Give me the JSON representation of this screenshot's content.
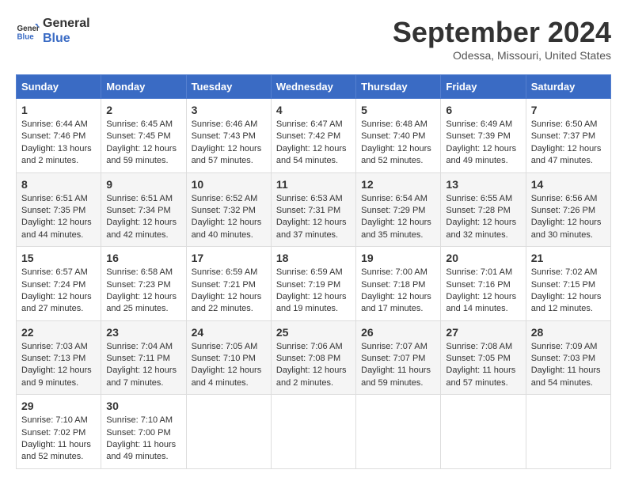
{
  "logo": {
    "line1": "General",
    "line2": "Blue"
  },
  "title": "September 2024",
  "location": "Odessa, Missouri, United States",
  "days_of_week": [
    "Sunday",
    "Monday",
    "Tuesday",
    "Wednesday",
    "Thursday",
    "Friday",
    "Saturday"
  ],
  "weeks": [
    [
      {
        "day": "1",
        "info": "Sunrise: 6:44 AM\nSunset: 7:46 PM\nDaylight: 13 hours\nand 2 minutes."
      },
      {
        "day": "2",
        "info": "Sunrise: 6:45 AM\nSunset: 7:45 PM\nDaylight: 12 hours\nand 59 minutes."
      },
      {
        "day": "3",
        "info": "Sunrise: 6:46 AM\nSunset: 7:43 PM\nDaylight: 12 hours\nand 57 minutes."
      },
      {
        "day": "4",
        "info": "Sunrise: 6:47 AM\nSunset: 7:42 PM\nDaylight: 12 hours\nand 54 minutes."
      },
      {
        "day": "5",
        "info": "Sunrise: 6:48 AM\nSunset: 7:40 PM\nDaylight: 12 hours\nand 52 minutes."
      },
      {
        "day": "6",
        "info": "Sunrise: 6:49 AM\nSunset: 7:39 PM\nDaylight: 12 hours\nand 49 minutes."
      },
      {
        "day": "7",
        "info": "Sunrise: 6:50 AM\nSunset: 7:37 PM\nDaylight: 12 hours\nand 47 minutes."
      }
    ],
    [
      {
        "day": "8",
        "info": "Sunrise: 6:51 AM\nSunset: 7:35 PM\nDaylight: 12 hours\nand 44 minutes."
      },
      {
        "day": "9",
        "info": "Sunrise: 6:51 AM\nSunset: 7:34 PM\nDaylight: 12 hours\nand 42 minutes."
      },
      {
        "day": "10",
        "info": "Sunrise: 6:52 AM\nSunset: 7:32 PM\nDaylight: 12 hours\nand 40 minutes."
      },
      {
        "day": "11",
        "info": "Sunrise: 6:53 AM\nSunset: 7:31 PM\nDaylight: 12 hours\nand 37 minutes."
      },
      {
        "day": "12",
        "info": "Sunrise: 6:54 AM\nSunset: 7:29 PM\nDaylight: 12 hours\nand 35 minutes."
      },
      {
        "day": "13",
        "info": "Sunrise: 6:55 AM\nSunset: 7:28 PM\nDaylight: 12 hours\nand 32 minutes."
      },
      {
        "day": "14",
        "info": "Sunrise: 6:56 AM\nSunset: 7:26 PM\nDaylight: 12 hours\nand 30 minutes."
      }
    ],
    [
      {
        "day": "15",
        "info": "Sunrise: 6:57 AM\nSunset: 7:24 PM\nDaylight: 12 hours\nand 27 minutes."
      },
      {
        "day": "16",
        "info": "Sunrise: 6:58 AM\nSunset: 7:23 PM\nDaylight: 12 hours\nand 25 minutes."
      },
      {
        "day": "17",
        "info": "Sunrise: 6:59 AM\nSunset: 7:21 PM\nDaylight: 12 hours\nand 22 minutes."
      },
      {
        "day": "18",
        "info": "Sunrise: 6:59 AM\nSunset: 7:19 PM\nDaylight: 12 hours\nand 19 minutes."
      },
      {
        "day": "19",
        "info": "Sunrise: 7:00 AM\nSunset: 7:18 PM\nDaylight: 12 hours\nand 17 minutes."
      },
      {
        "day": "20",
        "info": "Sunrise: 7:01 AM\nSunset: 7:16 PM\nDaylight: 12 hours\nand 14 minutes."
      },
      {
        "day": "21",
        "info": "Sunrise: 7:02 AM\nSunset: 7:15 PM\nDaylight: 12 hours\nand 12 minutes."
      }
    ],
    [
      {
        "day": "22",
        "info": "Sunrise: 7:03 AM\nSunset: 7:13 PM\nDaylight: 12 hours\nand 9 minutes."
      },
      {
        "day": "23",
        "info": "Sunrise: 7:04 AM\nSunset: 7:11 PM\nDaylight: 12 hours\nand 7 minutes."
      },
      {
        "day": "24",
        "info": "Sunrise: 7:05 AM\nSunset: 7:10 PM\nDaylight: 12 hours\nand 4 minutes."
      },
      {
        "day": "25",
        "info": "Sunrise: 7:06 AM\nSunset: 7:08 PM\nDaylight: 12 hours\nand 2 minutes."
      },
      {
        "day": "26",
        "info": "Sunrise: 7:07 AM\nSunset: 7:07 PM\nDaylight: 11 hours\nand 59 minutes."
      },
      {
        "day": "27",
        "info": "Sunrise: 7:08 AM\nSunset: 7:05 PM\nDaylight: 11 hours\nand 57 minutes."
      },
      {
        "day": "28",
        "info": "Sunrise: 7:09 AM\nSunset: 7:03 PM\nDaylight: 11 hours\nand 54 minutes."
      }
    ],
    [
      {
        "day": "29",
        "info": "Sunrise: 7:10 AM\nSunset: 7:02 PM\nDaylight: 11 hours\nand 52 minutes."
      },
      {
        "day": "30",
        "info": "Sunrise: 7:10 AM\nSunset: 7:00 PM\nDaylight: 11 hours\nand 49 minutes."
      },
      {
        "day": "",
        "info": ""
      },
      {
        "day": "",
        "info": ""
      },
      {
        "day": "",
        "info": ""
      },
      {
        "day": "",
        "info": ""
      },
      {
        "day": "",
        "info": ""
      }
    ]
  ]
}
